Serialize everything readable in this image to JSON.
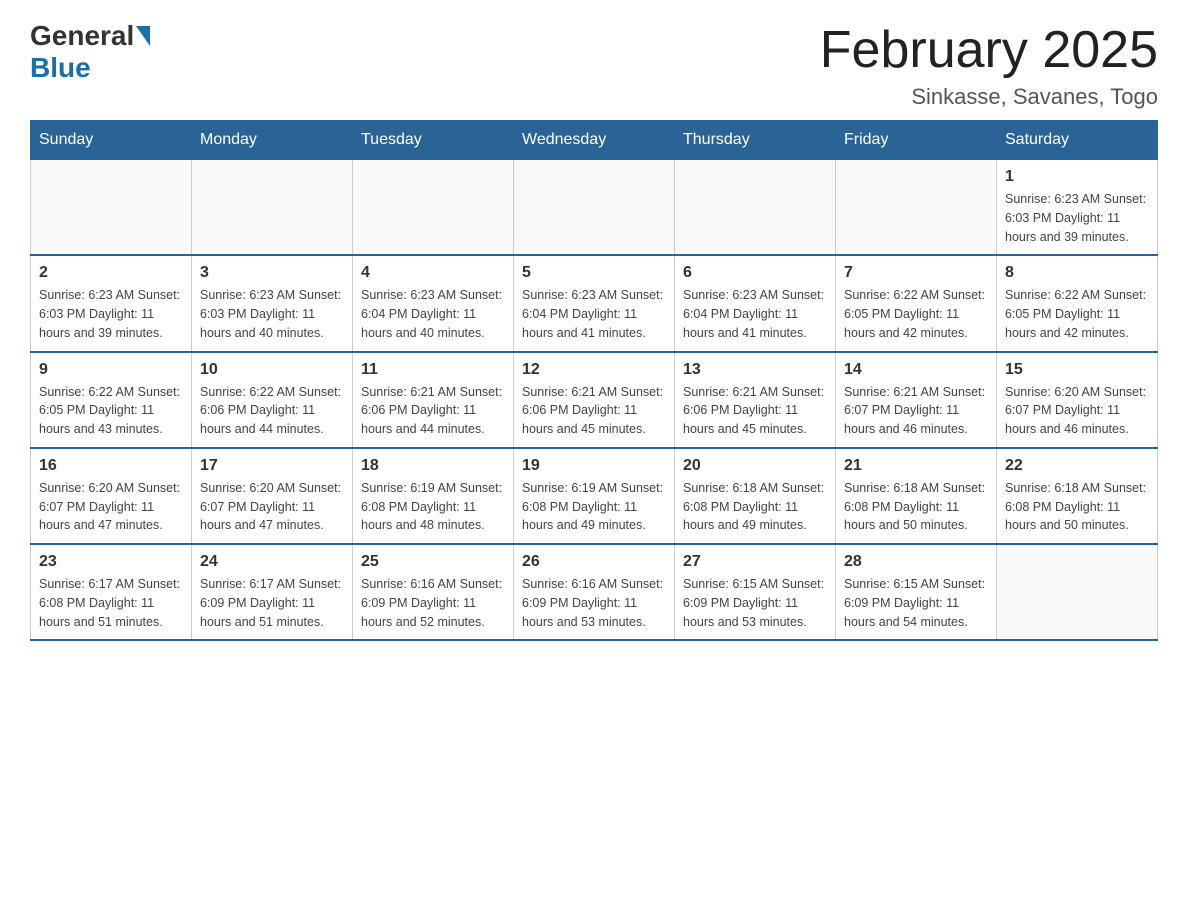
{
  "header": {
    "logo_general": "General",
    "logo_blue": "Blue",
    "title": "February 2025",
    "subtitle": "Sinkasse, Savanes, Togo"
  },
  "days_of_week": [
    "Sunday",
    "Monday",
    "Tuesday",
    "Wednesday",
    "Thursday",
    "Friday",
    "Saturday"
  ],
  "weeks": [
    [
      {
        "day": "",
        "info": ""
      },
      {
        "day": "",
        "info": ""
      },
      {
        "day": "",
        "info": ""
      },
      {
        "day": "",
        "info": ""
      },
      {
        "day": "",
        "info": ""
      },
      {
        "day": "",
        "info": ""
      },
      {
        "day": "1",
        "info": "Sunrise: 6:23 AM\nSunset: 6:03 PM\nDaylight: 11 hours\nand 39 minutes."
      }
    ],
    [
      {
        "day": "2",
        "info": "Sunrise: 6:23 AM\nSunset: 6:03 PM\nDaylight: 11 hours\nand 39 minutes."
      },
      {
        "day": "3",
        "info": "Sunrise: 6:23 AM\nSunset: 6:03 PM\nDaylight: 11 hours\nand 40 minutes."
      },
      {
        "day": "4",
        "info": "Sunrise: 6:23 AM\nSunset: 6:04 PM\nDaylight: 11 hours\nand 40 minutes."
      },
      {
        "day": "5",
        "info": "Sunrise: 6:23 AM\nSunset: 6:04 PM\nDaylight: 11 hours\nand 41 minutes."
      },
      {
        "day": "6",
        "info": "Sunrise: 6:23 AM\nSunset: 6:04 PM\nDaylight: 11 hours\nand 41 minutes."
      },
      {
        "day": "7",
        "info": "Sunrise: 6:22 AM\nSunset: 6:05 PM\nDaylight: 11 hours\nand 42 minutes."
      },
      {
        "day": "8",
        "info": "Sunrise: 6:22 AM\nSunset: 6:05 PM\nDaylight: 11 hours\nand 42 minutes."
      }
    ],
    [
      {
        "day": "9",
        "info": "Sunrise: 6:22 AM\nSunset: 6:05 PM\nDaylight: 11 hours\nand 43 minutes."
      },
      {
        "day": "10",
        "info": "Sunrise: 6:22 AM\nSunset: 6:06 PM\nDaylight: 11 hours\nand 44 minutes."
      },
      {
        "day": "11",
        "info": "Sunrise: 6:21 AM\nSunset: 6:06 PM\nDaylight: 11 hours\nand 44 minutes."
      },
      {
        "day": "12",
        "info": "Sunrise: 6:21 AM\nSunset: 6:06 PM\nDaylight: 11 hours\nand 45 minutes."
      },
      {
        "day": "13",
        "info": "Sunrise: 6:21 AM\nSunset: 6:06 PM\nDaylight: 11 hours\nand 45 minutes."
      },
      {
        "day": "14",
        "info": "Sunrise: 6:21 AM\nSunset: 6:07 PM\nDaylight: 11 hours\nand 46 minutes."
      },
      {
        "day": "15",
        "info": "Sunrise: 6:20 AM\nSunset: 6:07 PM\nDaylight: 11 hours\nand 46 minutes."
      }
    ],
    [
      {
        "day": "16",
        "info": "Sunrise: 6:20 AM\nSunset: 6:07 PM\nDaylight: 11 hours\nand 47 minutes."
      },
      {
        "day": "17",
        "info": "Sunrise: 6:20 AM\nSunset: 6:07 PM\nDaylight: 11 hours\nand 47 minutes."
      },
      {
        "day": "18",
        "info": "Sunrise: 6:19 AM\nSunset: 6:08 PM\nDaylight: 11 hours\nand 48 minutes."
      },
      {
        "day": "19",
        "info": "Sunrise: 6:19 AM\nSunset: 6:08 PM\nDaylight: 11 hours\nand 49 minutes."
      },
      {
        "day": "20",
        "info": "Sunrise: 6:18 AM\nSunset: 6:08 PM\nDaylight: 11 hours\nand 49 minutes."
      },
      {
        "day": "21",
        "info": "Sunrise: 6:18 AM\nSunset: 6:08 PM\nDaylight: 11 hours\nand 50 minutes."
      },
      {
        "day": "22",
        "info": "Sunrise: 6:18 AM\nSunset: 6:08 PM\nDaylight: 11 hours\nand 50 minutes."
      }
    ],
    [
      {
        "day": "23",
        "info": "Sunrise: 6:17 AM\nSunset: 6:08 PM\nDaylight: 11 hours\nand 51 minutes."
      },
      {
        "day": "24",
        "info": "Sunrise: 6:17 AM\nSunset: 6:09 PM\nDaylight: 11 hours\nand 51 minutes."
      },
      {
        "day": "25",
        "info": "Sunrise: 6:16 AM\nSunset: 6:09 PM\nDaylight: 11 hours\nand 52 minutes."
      },
      {
        "day": "26",
        "info": "Sunrise: 6:16 AM\nSunset: 6:09 PM\nDaylight: 11 hours\nand 53 minutes."
      },
      {
        "day": "27",
        "info": "Sunrise: 6:15 AM\nSunset: 6:09 PM\nDaylight: 11 hours\nand 53 minutes."
      },
      {
        "day": "28",
        "info": "Sunrise: 6:15 AM\nSunset: 6:09 PM\nDaylight: 11 hours\nand 54 minutes."
      },
      {
        "day": "",
        "info": ""
      }
    ]
  ]
}
